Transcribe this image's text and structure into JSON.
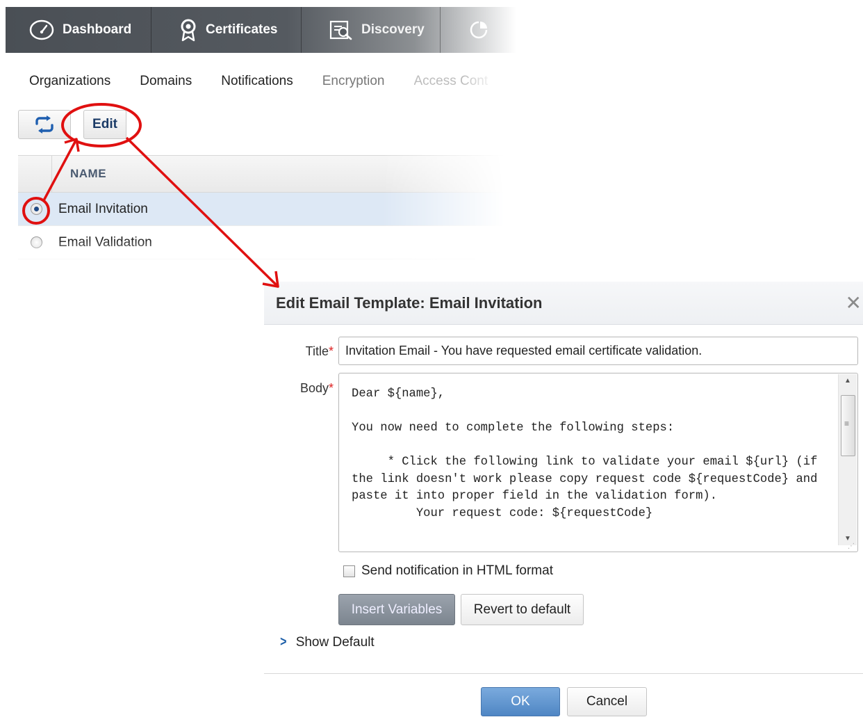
{
  "topnav": {
    "items": [
      {
        "label": "Dashboard",
        "icon": "speedometer-icon"
      },
      {
        "label": "Certificates",
        "icon": "certificate-badge-icon"
      },
      {
        "label": "Discovery",
        "icon": "discovery-scan-icon"
      },
      {
        "label": "",
        "icon": "reports-icon"
      }
    ]
  },
  "subtabs": [
    "Organizations",
    "Domains",
    "Notifications",
    "Encryption",
    "Access Cont"
  ],
  "toolbar": {
    "refresh_icon": "refresh-icon",
    "edit_label": "Edit"
  },
  "grid": {
    "column_name": "NAME",
    "rows": [
      {
        "name": "Email Invitation",
        "selected": true
      },
      {
        "name": "Email Validation",
        "selected": false
      }
    ]
  },
  "dialog": {
    "title": "Edit Email Template: Email Invitation",
    "close_icon": "close-icon",
    "title_label": "Title",
    "body_label": "Body",
    "required_mark": "*",
    "title_value": "Invitation Email - You have requested email certificate validation.",
    "body_value": "Dear ${name},\n\nYou now need to complete the following steps:\n\n     * Click the following link to validate your email ${url} (if the link doesn't work please copy request code ${requestCode} and paste it into proper field in the validation form).\n         Your request code: ${requestCode}",
    "html_checkbox_label": "Send notification in HTML format",
    "html_checkbox_checked": false,
    "insert_variables_label": "Insert Variables",
    "revert_label": "Revert to default",
    "show_default_label": "Show Default",
    "ok_label": "OK",
    "cancel_label": "Cancel"
  },
  "colors": {
    "nav_bg": "#4a4f55",
    "selection_bg": "#dde8f5",
    "primary_button": "#5a8fcb",
    "annotation_red": "#e01010"
  }
}
